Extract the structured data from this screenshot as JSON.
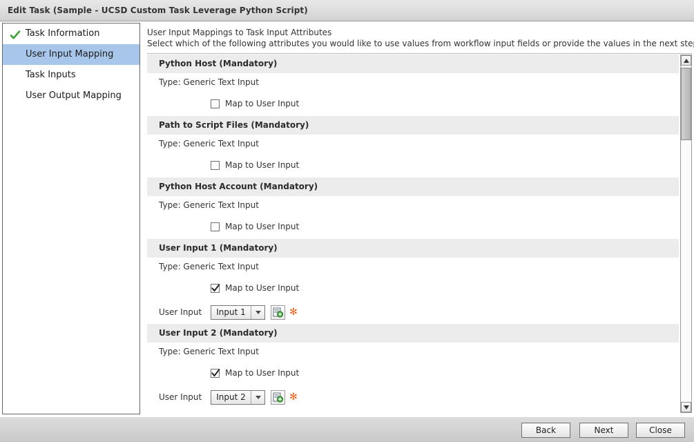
{
  "window": {
    "title": "Edit Task (Sample - UCSD Custom Task Leverage Python Script)"
  },
  "sidebar": {
    "items": [
      {
        "label": "Task Information",
        "state": "completed",
        "icon": "check-icon"
      },
      {
        "label": "User Input Mapping",
        "state": "selected",
        "icon": ""
      },
      {
        "label": "Task Inputs",
        "state": "normal",
        "icon": ""
      },
      {
        "label": "User Output Mapping",
        "state": "normal",
        "icon": ""
      }
    ]
  },
  "main": {
    "heading": "User Input Mappings to Task Input Attributes",
    "description": "Select which of the following attributes you would like to use values from workflow input fields or provide the values in the next step.",
    "attributes": [
      {
        "title": "Python Host (Mandatory)",
        "type_label": "Type: Generic Text Input",
        "map_label": "Map to User Input",
        "mapped": false
      },
      {
        "title": "Path to Script Files (Mandatory)",
        "type_label": "Type: Generic Text Input",
        "map_label": "Map to User Input",
        "mapped": false
      },
      {
        "title": "Python Host Account (Mandatory)",
        "type_label": "Type: Generic Text Input",
        "map_label": "Map to User Input",
        "mapped": false
      },
      {
        "title": "User Input 1 (Mandatory)",
        "type_label": "Type: Generic Text Input",
        "map_label": "Map to User Input",
        "mapped": true,
        "input_label": "User Input",
        "input_value": "Input 1",
        "add_icon": "add-document-icon",
        "required_marker": "✻"
      },
      {
        "title": "User Input 2 (Mandatory)",
        "type_label": "Type: Generic Text Input",
        "map_label": "Map to User Input",
        "mapped": true,
        "input_label": "User Input",
        "input_value": "Input 2",
        "add_icon": "add-document-icon",
        "required_marker": "✻"
      }
    ]
  },
  "scrollbar": {
    "up_icon": "triangle-up-icon",
    "down_icon": "triangle-down-icon"
  },
  "footer": {
    "back_label": "Back",
    "next_label": "Next",
    "close_label": "Close"
  },
  "colors": {
    "selection": "#a8c6ea",
    "section_header_bg": "#ececec",
    "required_marker": "#e8621a",
    "check_green": "#3a9e35"
  }
}
